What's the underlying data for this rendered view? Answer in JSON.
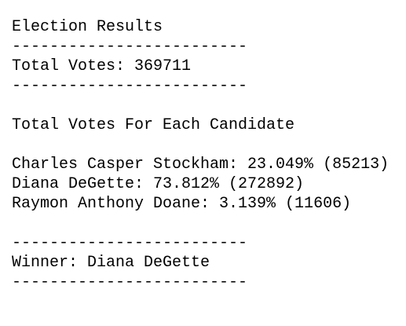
{
  "output": {
    "title": "Election Results",
    "separator": "-------------------------",
    "total_votes": "Total Votes: 369711",
    "section_heading": "Total Votes For Each Candidate",
    "candidates": [
      "Charles Casper Stockham: 23.049% (85213)",
      "Diana DeGette: 73.812% (272892)",
      "Raymon Anthony Doane: 3.139% (11606)"
    ],
    "winner": "Winner: Diana DeGette"
  }
}
